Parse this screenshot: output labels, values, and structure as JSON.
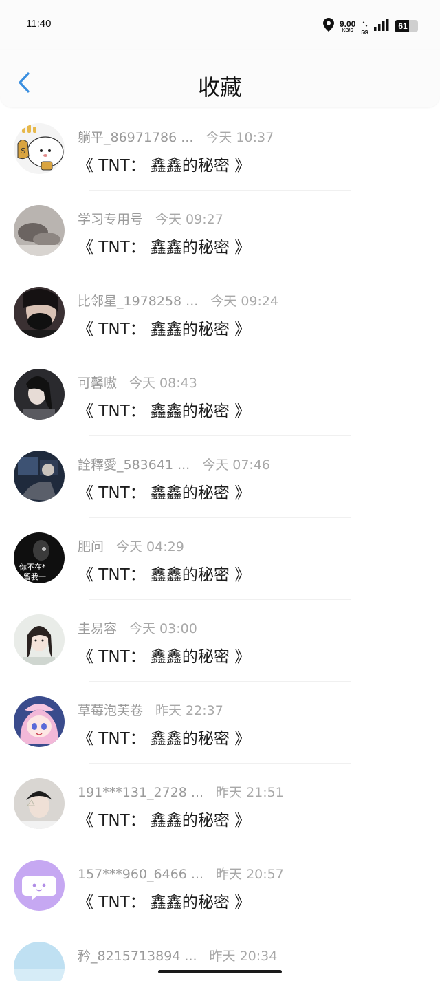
{
  "status_bar": {
    "time": "11:40",
    "net_speed": "9.00",
    "net_speed_unit": "KB/S",
    "net_type": "5G",
    "battery": "61",
    "battery_level": 0.61
  },
  "header": {
    "title": "收藏"
  },
  "items": [
    {
      "name": "躺平_86971786 ...",
      "time": "今天 10:37",
      "title": "《 TNT： 鑫鑫的秘密 》",
      "avatar": "cartoon-money"
    },
    {
      "name": "学习专用号",
      "time": "今天 09:27",
      "title": "《 TNT： 鑫鑫的秘密 》",
      "avatar": "photo-gray"
    },
    {
      "name": "比邻星_1978258 ...",
      "time": "今天 09:24",
      "title": "《 TNT： 鑫鑫的秘密 》",
      "avatar": "photo-mask"
    },
    {
      "name": "可馨嗷",
      "time": "今天 08:43",
      "title": "《 TNT： 鑫鑫的秘密 》",
      "avatar": "photo-girl-dark"
    },
    {
      "name": "詮釋愛_583641 ...",
      "time": "今天 07:46",
      "title": "《 TNT： 鑫鑫的秘密 》",
      "avatar": "photo-blue-night"
    },
    {
      "name": "肥问",
      "time": "今天 04:29",
      "title": "《 TNT： 鑫鑫的秘密 》",
      "avatar": "photo-black-text",
      "avatar_text": [
        "你不在*",
        "留我一"
      ]
    },
    {
      "name": "圭易容",
      "time": "今天 03:00",
      "title": "《 TNT： 鑫鑫的秘密 》",
      "avatar": "photo-girl-light"
    },
    {
      "name": "草莓泡芙卷",
      "time": "昨天 22:37",
      "title": "《 TNT： 鑫鑫的秘密 》",
      "avatar": "anime-pink"
    },
    {
      "name": "191***131_2728 ...",
      "time": "昨天 21:51",
      "title": "《 TNT： 鑫鑫的秘密 》",
      "avatar": "photo-boy"
    },
    {
      "name": "157***960_6466 ...",
      "time": "昨天 20:57",
      "title": "《 TNT： 鑫鑫的秘密 》",
      "avatar": "default-purple"
    },
    {
      "name": "矜_8215713894 ...",
      "time": "昨天 20:34",
      "title": "",
      "avatar": "light-blue"
    }
  ],
  "colors": {
    "accent": "#3a8fe0",
    "meta_text": "#9a9a9a",
    "title_text": "#1c1c1c",
    "default_avatar": "#c6a8f2"
  }
}
